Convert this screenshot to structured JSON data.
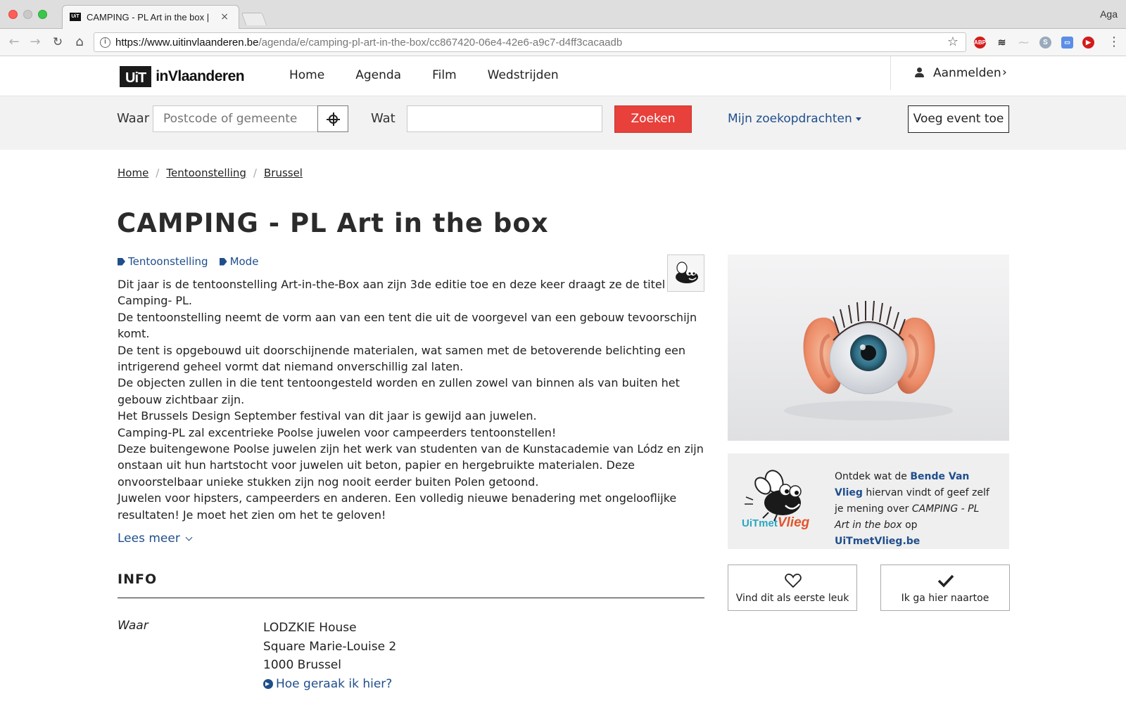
{
  "browser": {
    "tab_title": "CAMPING - PL Art in the box |",
    "tab_favicon_text": "UiT",
    "tab_close": "×",
    "profile_name": "Aga",
    "url_host": "https://www.uitinvlaanderen.be",
    "url_path": "/agenda/e/camping-pl-art-in-the-box/cc867420-06e4-42e6-a9c7-d4ff3cacaadb",
    "ext_abp": "ABP"
  },
  "site": {
    "logo_uit": "UiT",
    "logo_vlaanderen": "inVlaanderen",
    "nav": [
      "Home",
      "Agenda",
      "Film",
      "Wedstrijden"
    ],
    "login_label": "Aanmelden"
  },
  "search": {
    "waar_label": "Waar",
    "waar_placeholder": "Postcode of gemeente",
    "wat_label": "Wat",
    "wat_value": "",
    "submit_label": "Zoeken",
    "saved_searches_label": "Mijn zoekopdrachten",
    "add_event_label": "Voeg event toe"
  },
  "breadcrumb": [
    "Home",
    "Tentoonstelling",
    "Brussel"
  ],
  "event": {
    "title": "CAMPING - PL Art in the box",
    "tags": [
      "Tentoonstelling",
      "Mode"
    ],
    "description": [
      "Dit jaar is de tentoonstelling Art-in-the-Box aan zijn 3de editie toe en deze keer draagt ze de titel Camping- PL.",
      "De tentoonstelling neemt de vorm aan van een tent die uit de voorgevel van een gebouw tevoorschijn komt.",
      "De tent is opgebouwd uit doorschijnende materialen, wat samen met de betoverende belichting een intrigerend geheel vormt dat niemand onverschillig zal laten.",
      "De objecten zullen in die tent tentoongesteld worden en zullen zowel van binnen als van buiten het gebouw zichtbaar zijn.",
      "Het Brussels Design September festival van dit jaar is gewijd aan juwelen.",
      "Camping-PL zal excentrieke Poolse juwelen voor campeerders tentoonstellen!",
      "Deze buitengewone Poolse juwelen zijn het werk van studenten van de Kunstacademie van Lódz en zijn onstaan uit hun hartstocht voor juwelen uit beton, papier en hergebruikte materialen. Deze onvoorstelbaar unieke stukken zijn nog nooit eerder buiten Polen getoond.",
      "Juwelen voor hipsters, campeerders en anderen. Een volledig nieuwe benadering met ongelooflijke resultaten! Je moet het zien om het te geloven!"
    ],
    "read_more_label": "Lees meer",
    "info_heading": "INFO",
    "where_label": "Waar",
    "venue": "LODZKIE House",
    "street": "Square Marie-Louise 2",
    "city": "1000 Brussel",
    "directions_label": "Hoe geraak ik hier?"
  },
  "promo": {
    "text_1": "Ontdek wat de ",
    "link_1": "Bende Van Vlieg",
    "text_2": " hiervan vindt of geef zelf je mening over ",
    "event_name": "CAMPING - PL Art in the box",
    "text_3": " op ",
    "link_2": "UiTmetVlieg.be",
    "logo_text_a": "UiTmet",
    "logo_text_b": "Vlieg"
  },
  "actions": {
    "like_label": "Vind dit als eerste leuk",
    "attend_label": "Ik ga hier naartoe"
  },
  "colors": {
    "accent_red": "#e8403a",
    "link_blue": "#1f4e8c"
  },
  "icons": [
    "info-icon",
    "star-icon",
    "user-icon",
    "crosshair-icon",
    "tag-icon",
    "heart-icon",
    "check-icon",
    "arrow-circle-icon",
    "chevron-down-icon"
  ]
}
